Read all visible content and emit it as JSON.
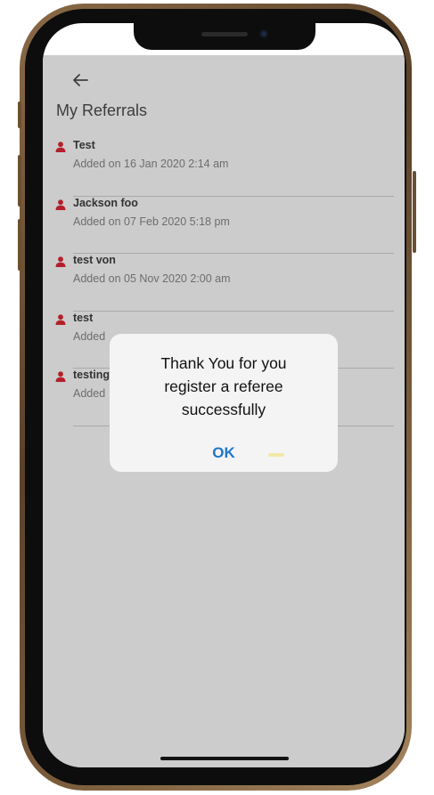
{
  "header": {
    "back_icon": "arrow-left-icon",
    "title": "My Referrals"
  },
  "referrals": [
    {
      "name": "Test",
      "added": "Added on 16 Jan 2020 2:14 am"
    },
    {
      "name": "Jackson foo",
      "added": "Added on 07 Feb 2020 5:18 pm"
    },
    {
      "name": "test von",
      "added": "Added on 05 Nov 2020 2:00 am"
    },
    {
      "name": "test",
      "added": "Added"
    },
    {
      "name": "testing",
      "added": "Added"
    }
  ],
  "dialog": {
    "message": "Thank You for you\nregister a referee\nsuccessfully",
    "ok_label": "OK"
  },
  "colors": {
    "background": "#cccccc",
    "icon": "#b3202a",
    "ok": "#1f76c8",
    "dialog": "#f4f4f4"
  }
}
